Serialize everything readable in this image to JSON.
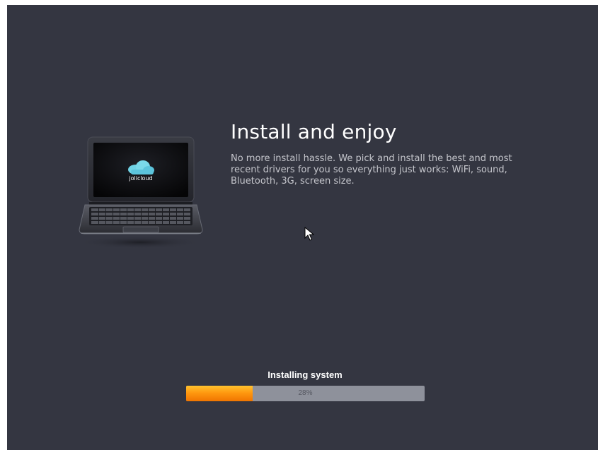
{
  "screen": {
    "headline": "Install and enjoy",
    "description": "No more install hassle. We pick and install the best and most recent drivers for you so everything just works: WiFi, sound, Bluetooth, 3G, screen size.",
    "laptop_brand": "jolicloud"
  },
  "progress": {
    "label": "Installing system",
    "percent_text": "28%",
    "value": 0.28
  },
  "colors": {
    "background": "#343641",
    "progress_fill": "#ff9910",
    "progress_track": "#8e919b"
  }
}
